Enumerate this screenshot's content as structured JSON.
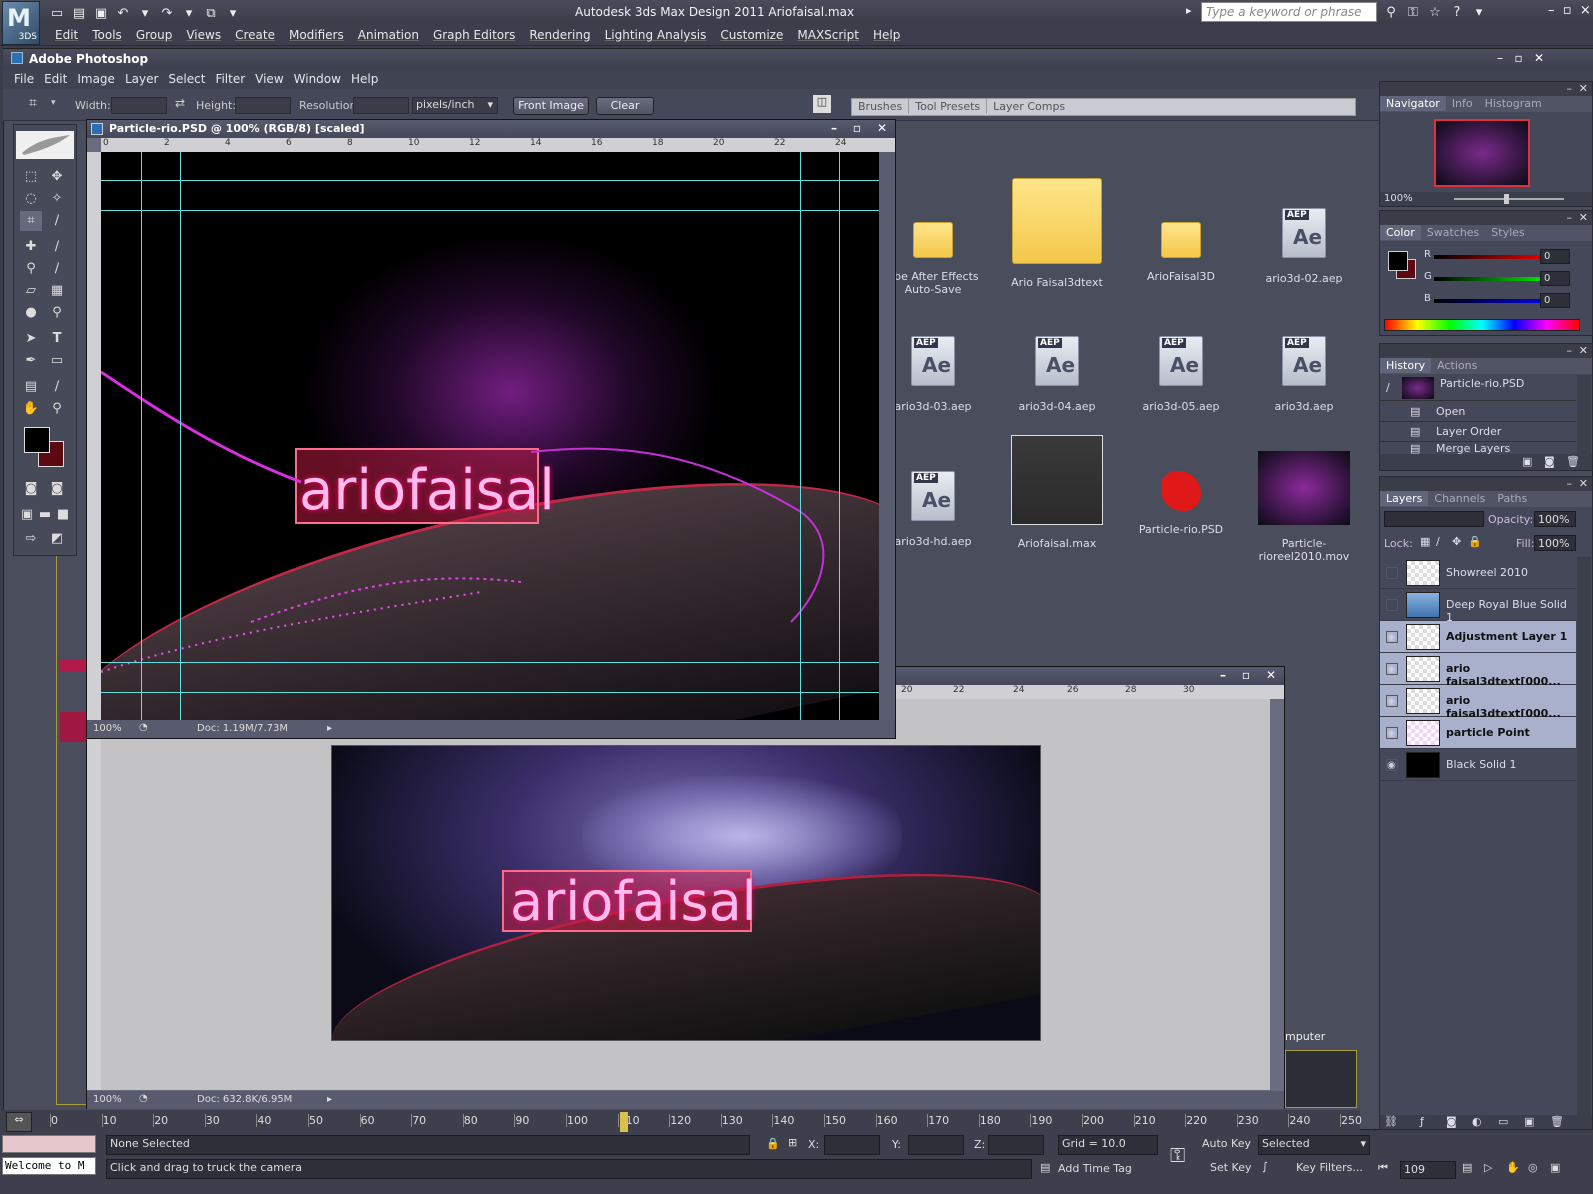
{
  "max": {
    "logo_text": "3DS",
    "title": "Autodesk 3ds Max Design 2011      Ariofaisal.max",
    "search_placeholder": "Type a keyword or phrase",
    "menu": [
      "Edit",
      "Tools",
      "Group",
      "Views",
      "Create",
      "Modifiers",
      "Animation",
      "Graph Editors",
      "Rendering",
      "Lighting Analysis",
      "Customize",
      "MAXScript",
      "Help"
    ],
    "timeline_ticks": [
      "0",
      "10",
      "20",
      "30",
      "40",
      "50",
      "60",
      "70",
      "80",
      "90",
      "100",
      "110",
      "120",
      "130",
      "140",
      "150",
      "160",
      "170",
      "180",
      "190",
      "200",
      "210",
      "220",
      "230",
      "240",
      "250"
    ],
    "status_selection": "None Selected",
    "prompt": "Click and drag to truck the camera",
    "welcome": "Welcome to M",
    "x_label": "X:",
    "y_label": "Y:",
    "z_label": "Z:",
    "grid": "Grid = 10.0",
    "add_time_tag": "Add Time Tag",
    "auto_key": "Auto Key",
    "set_key": "Set Key",
    "selected": "Selected",
    "key_filters": "Key Filters...",
    "frame": "109",
    "computer_label": "mputer"
  },
  "ps": {
    "title": "Adobe Photoshop",
    "menu": [
      "File",
      "Edit",
      "Image",
      "Layer",
      "Select",
      "Filter",
      "View",
      "Window",
      "Help"
    ],
    "options": {
      "width_label": "Width:",
      "height_label": "Height:",
      "resolution_label": "Resolution:",
      "units": "pixels/inch",
      "front_image": "Front Image",
      "clear": "Clear"
    },
    "dock_tabs": [
      "Brushes",
      "Tool Presets",
      "Layer Comps"
    ],
    "doc1": {
      "title": "Particle-rio.PSD @ 100% (RGB/8) [scaled]",
      "zoom": "100%",
      "doc_size": "Doc: 1.19M/7.73M",
      "ruler": [
        "0",
        "2",
        "4",
        "6",
        "8",
        "10",
        "12",
        "14",
        "16",
        "18",
        "20",
        "22",
        "24"
      ],
      "logo_text": "ariofaisal"
    },
    "doc2": {
      "zoom": "100%",
      "doc_size": "Doc: 632.8K/6.95M",
      "ruler": [
        "20",
        "22",
        "24",
        "26",
        "28",
        "30"
      ],
      "logo_text": "ariofaisal"
    },
    "navigator": {
      "tabs": [
        "Navigator",
        "Info",
        "Histogram"
      ],
      "zoom": "100%"
    },
    "color": {
      "tabs": [
        "Color",
        "Swatches",
        "Styles"
      ],
      "r": "0",
      "g": "0",
      "b": "0",
      "r_label": "R",
      "g_label": "G",
      "b_label": "B"
    },
    "history": {
      "tabs": [
        "History",
        "Actions"
      ],
      "snapshot": "Particle-rio.PSD",
      "items": [
        "Open",
        "Layer Order",
        "Merge Layers"
      ]
    },
    "layers": {
      "tabs": [
        "Layers",
        "Channels",
        "Paths"
      ],
      "opacity_label": "Opacity:",
      "opacity": "100%",
      "lock_label": "Lock:",
      "fill_label": "Fill:",
      "fill": "100%",
      "items": [
        {
          "name": "Showreel 2010",
          "selected": false,
          "visible": false
        },
        {
          "name": "Deep Royal Blue Solid 1",
          "selected": false,
          "visible": false
        },
        {
          "name": "Adjustment Layer 1",
          "selected": true,
          "visible": true
        },
        {
          "name": "ario faisal3dtext[000...",
          "selected": true,
          "visible": true
        },
        {
          "name": "ario faisal3dtext[000...",
          "selected": true,
          "visible": true
        },
        {
          "name": "particle Point",
          "selected": true,
          "visible": true
        },
        {
          "name": "Black Solid 1",
          "selected": false,
          "visible": true
        }
      ]
    }
  },
  "files": [
    {
      "name": "obe After Effects Auto-Save",
      "kind": "folder"
    },
    {
      "name": "Ario Faisal3dtext",
      "kind": "bigfolder"
    },
    {
      "name": "ArioFaisal3D",
      "kind": "folder"
    },
    {
      "name": "ario3d-02.aep",
      "kind": "aep"
    },
    {
      "name": "ario3d-03.aep",
      "kind": "aep"
    },
    {
      "name": "ario3d-04.aep",
      "kind": "aep"
    },
    {
      "name": "ario3d-05.aep",
      "kind": "aep"
    },
    {
      "name": "ario3d.aep",
      "kind": "aep"
    },
    {
      "name": "ario3d-hd.aep",
      "kind": "aep"
    },
    {
      "name": "Ariofaisal.max",
      "kind": "max"
    },
    {
      "name": "Particle-rio.PSD",
      "kind": "psd"
    },
    {
      "name": "Particle-rioreel2010.mov",
      "kind": "mov"
    }
  ],
  "aep_badge": "AEP",
  "ae_text": "Ae"
}
